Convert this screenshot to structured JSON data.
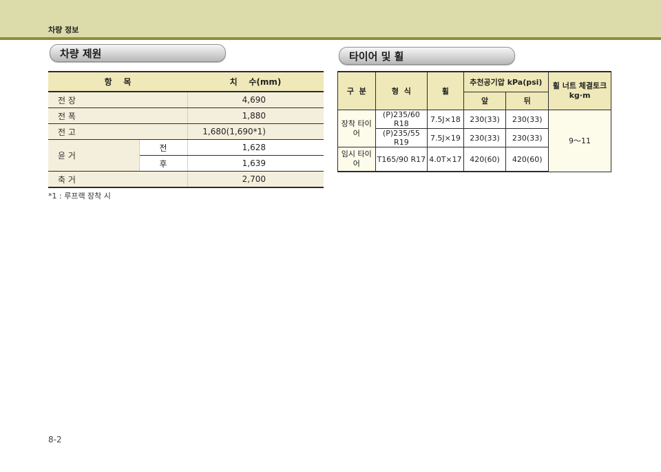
{
  "header": {
    "title": "차량 정보"
  },
  "spec_section": {
    "title": "차량 제원",
    "columns": [
      "항    목",
      "치    수(mm)"
    ],
    "rows": {
      "length": {
        "label": "전 장",
        "value": "4,690"
      },
      "width": {
        "label": "전 폭",
        "value": "1,880"
      },
      "height": {
        "label": "전 고",
        "value": "1,680(1,690*1)"
      },
      "tread": {
        "label": "윤 거",
        "front_label": "전",
        "front_value": "1,628",
        "rear_label": "후",
        "rear_value": "1,639"
      },
      "wheelbase": {
        "label": "축 거",
        "value": "2,700"
      }
    },
    "note": "*1 : 루프랙 장착 시"
  },
  "tire_section": {
    "title": "타이어 및 휠",
    "headers": {
      "category": "구  분",
      "type": "형  식",
      "wheel": "휠",
      "pressure": "추천공기압 kPa(psi)",
      "front": "앞",
      "rear": "뒤",
      "torque": "휠 너트 체결토크 kg·m"
    },
    "standard_label": "장착 타이어",
    "rows": [
      {
        "type": "(P)235/60 R18",
        "wheel": "7.5J×18",
        "front": "230(33)",
        "rear": "230(33)"
      },
      {
        "type": "(P)235/55 R19",
        "wheel": "7.5J×19",
        "front": "230(33)",
        "rear": "230(33)"
      }
    ],
    "temp_label": "임시 타이어",
    "temp_row": {
      "type": "T165/90 R17",
      "wheel": "4.0T×17",
      "front": "420(60)",
      "rear": "420(60)"
    },
    "torque_value": "9～11"
  },
  "footer": {
    "page_number": "8-2"
  }
}
